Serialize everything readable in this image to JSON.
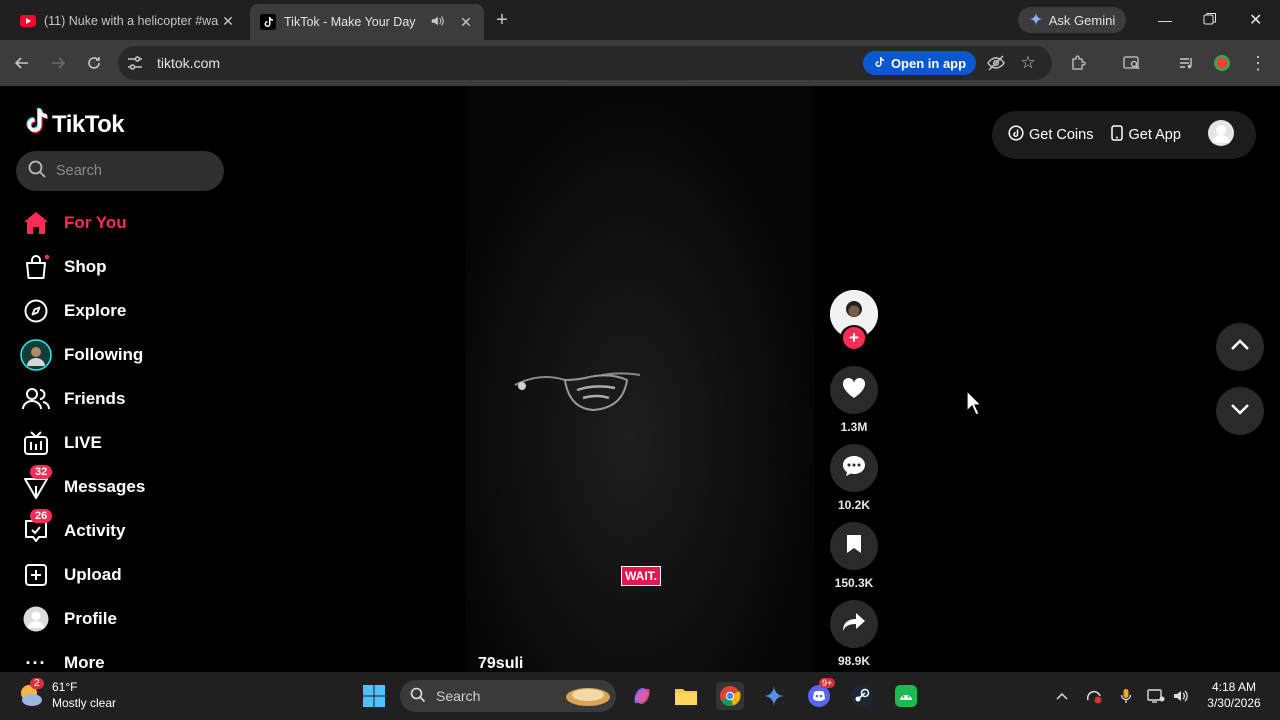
{
  "browser": {
    "tabs": [
      {
        "title": "(11) Nuke with a helicopter #wa",
        "active": false
      },
      {
        "title": "TikTok - Make Your Day",
        "active": true
      }
    ],
    "ask_gemini": "Ask Gemini",
    "url": "tiktok.com",
    "open_in_app": "Open in app"
  },
  "tiktok": {
    "brand": "TikTok",
    "search_placeholder": "Search",
    "nav": [
      {
        "label": "For You",
        "icon": "home-icon",
        "active": true
      },
      {
        "label": "Shop",
        "icon": "shopping-bag-icon"
      },
      {
        "label": "Explore",
        "icon": "compass-icon"
      },
      {
        "label": "Following",
        "icon": "following-avatar-icon"
      },
      {
        "label": "Friends",
        "icon": "friends-icon"
      },
      {
        "label": "LIVE",
        "icon": "live-icon"
      },
      {
        "label": "Messages",
        "icon": "messages-icon",
        "badge": "32"
      },
      {
        "label": "Activity",
        "icon": "activity-icon",
        "badge": "26"
      },
      {
        "label": "Upload",
        "icon": "upload-icon"
      },
      {
        "label": "Profile",
        "icon": "profile-icon"
      },
      {
        "label": "More",
        "icon": "more-icon"
      }
    ],
    "top_right": {
      "get_coins": "Get Coins",
      "get_app": "Get App"
    },
    "video": {
      "author": "79suli",
      "caption_badge": "WAIT.",
      "likes": "1.3M",
      "comments": "10.2K",
      "saves": "150.3K",
      "shares": "98.9K"
    }
  },
  "taskbar": {
    "weather_temp": "61°F",
    "weather_desc": "Mostly clear",
    "weather_badge": "2",
    "search": "Search",
    "discord_badge": "9+",
    "time": "4:18 AM",
    "date": "3/30/2026"
  },
  "colors": {
    "accent": "#fe2c55",
    "chrome_bg": "#1f1f1f",
    "toolbar_bg": "#3c3c3c",
    "open_app_bg": "#0b57d0"
  }
}
